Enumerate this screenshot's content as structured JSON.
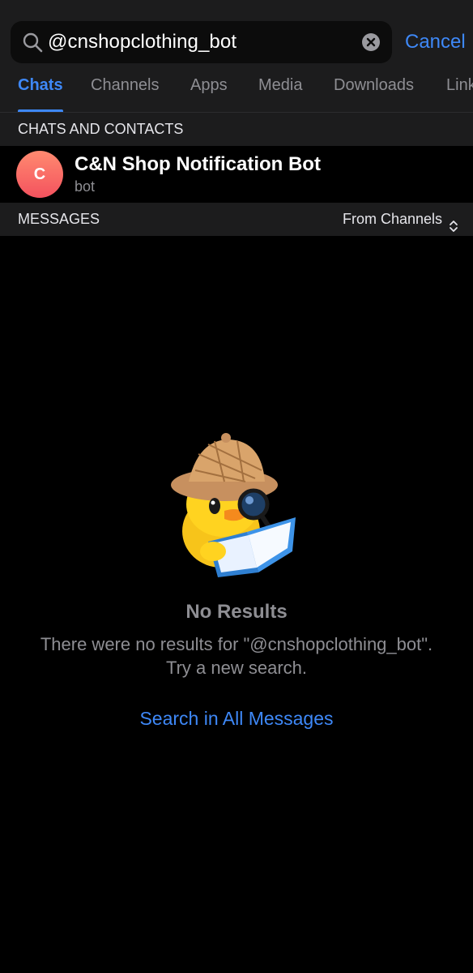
{
  "search": {
    "query": "@cnshopclothing_bot",
    "cancel_label": "Cancel"
  },
  "tabs": [
    {
      "label": "Chats",
      "active": true
    },
    {
      "label": "Channels",
      "active": false
    },
    {
      "label": "Apps",
      "active": false
    },
    {
      "label": "Media",
      "active": false
    },
    {
      "label": "Downloads",
      "active": false
    },
    {
      "label": "Links",
      "active": false
    }
  ],
  "sections": {
    "chats_contacts": "CHATS AND CONTACTS",
    "messages": "MESSAGES"
  },
  "chat_result": {
    "avatar_letter": "C",
    "title": "C&N Shop Notification Bot",
    "subtitle": "bot"
  },
  "messages_filter": {
    "label": "From Channels"
  },
  "empty_state": {
    "title": "No Results",
    "line1": "There were no results for \"@cnshopclothing_bot\".",
    "line2": "Try a new search.",
    "action": "Search in All Messages"
  },
  "colors": {
    "accent": "#3e88f7",
    "background": "#000000",
    "header_background": "#1c1c1d",
    "secondary_text": "#8e8e93"
  }
}
